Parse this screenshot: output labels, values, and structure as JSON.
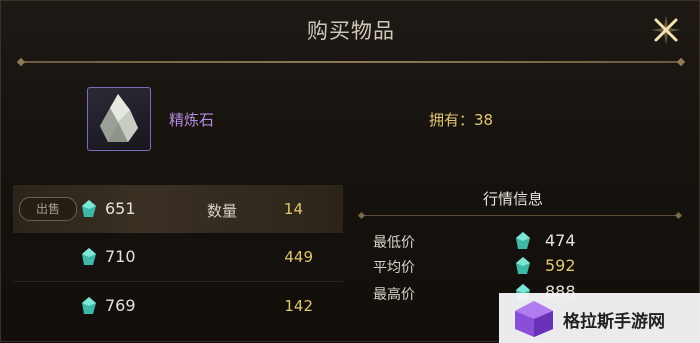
{
  "dialog": {
    "title": "购买物品",
    "close_icon": "close-x-icon"
  },
  "item": {
    "name": "精炼石",
    "owned_text": "拥有：38",
    "icon": "crystal-stone-icon"
  },
  "orders": {
    "sell_badge": "出售",
    "quantity_label": "数量",
    "currency_icon": "gem-currency-icon",
    "rows": [
      {
        "price": "651",
        "qty": "14"
      },
      {
        "price": "710",
        "qty": "449"
      },
      {
        "price": "769",
        "qty": "142"
      }
    ]
  },
  "market": {
    "title": "行情信息",
    "stats": [
      {
        "label": "最低价",
        "value": "474",
        "color": "#e6e2da"
      },
      {
        "label": "平均价",
        "value": "592",
        "color": "#e2c671"
      },
      {
        "label": "最高价",
        "value": "888",
        "color": "#e6e2da"
      }
    ]
  },
  "watermark": {
    "text": "格拉斯手游网"
  },
  "colors": {
    "accent_gold": "#e2c671",
    "item_purple": "#b48ce0",
    "frame_purple": "#7d6bc0"
  }
}
